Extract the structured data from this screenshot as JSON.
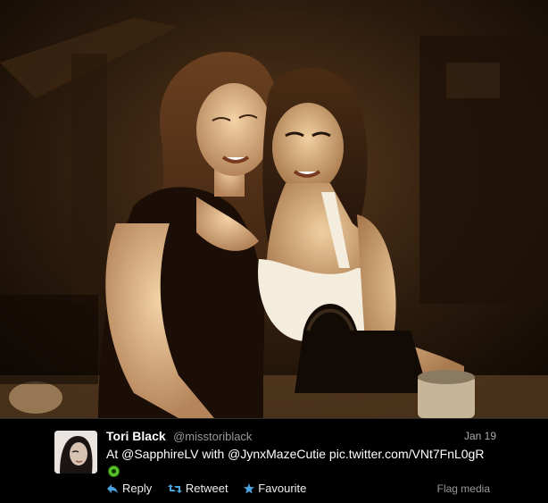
{
  "photo": {
    "icon": "media-photo"
  },
  "tweet": {
    "name": "Tori Black",
    "handle": "@misstoriblack",
    "date": "Jan 19",
    "text": "At @SapphireLV with @JynxMazeCutie pic.twitter.com/VNt7FnL0gR",
    "attachment_icon": "green-circle-icon"
  },
  "actions": {
    "reply": "Reply",
    "retweet": "Retweet",
    "favourite": "Favourite",
    "flag_media": "Flag media"
  },
  "colors": {
    "accent": "#4aa3df",
    "panel_bg": "#000000",
    "text_primary": "#ffffff",
    "text_muted": "#999999",
    "dot_green": "#5cbf2a"
  }
}
